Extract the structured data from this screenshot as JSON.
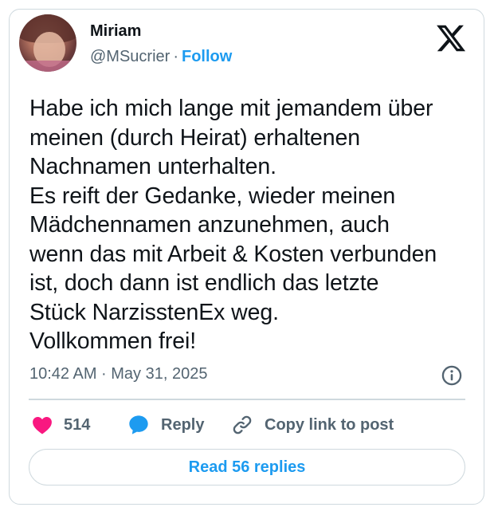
{
  "author": {
    "name": "Miriam",
    "handle": "@MSucrier",
    "separator": "·",
    "follow_label": "Follow",
    "avatar_icon": "user-avatar-photo"
  },
  "brand": {
    "logo_icon": "x-logo-icon"
  },
  "tweet": {
    "text": "Habe ich mich lange mit jemandem über\nmeinen (durch Heirat) erhaltenen\nNachnamen unterhalten.\nEs reift der Gedanke, wieder meinen\nMädchennamen anzunehmen, auch\nwenn das mit Arbeit & Kosten verbunden\nist, doch dann ist endlich das letzte\nStück NarzisstenEx weg.\nVollkommen frei!",
    "timestamp": "10:42 AM · May 31, 2025",
    "info_icon": "info-icon"
  },
  "actions": {
    "like_count": "514",
    "like_icon": "heart-icon",
    "reply_label": "Reply",
    "reply_icon": "speech-bubble-icon",
    "copy_label": "Copy link to post",
    "copy_icon": "link-icon"
  },
  "footer": {
    "read_replies_label": "Read 56 replies"
  },
  "colors": {
    "accent": "#1d9bf0",
    "like": "#f91880",
    "text_primary": "#0f1419",
    "text_secondary": "#536471",
    "border": "#cfd9de"
  }
}
